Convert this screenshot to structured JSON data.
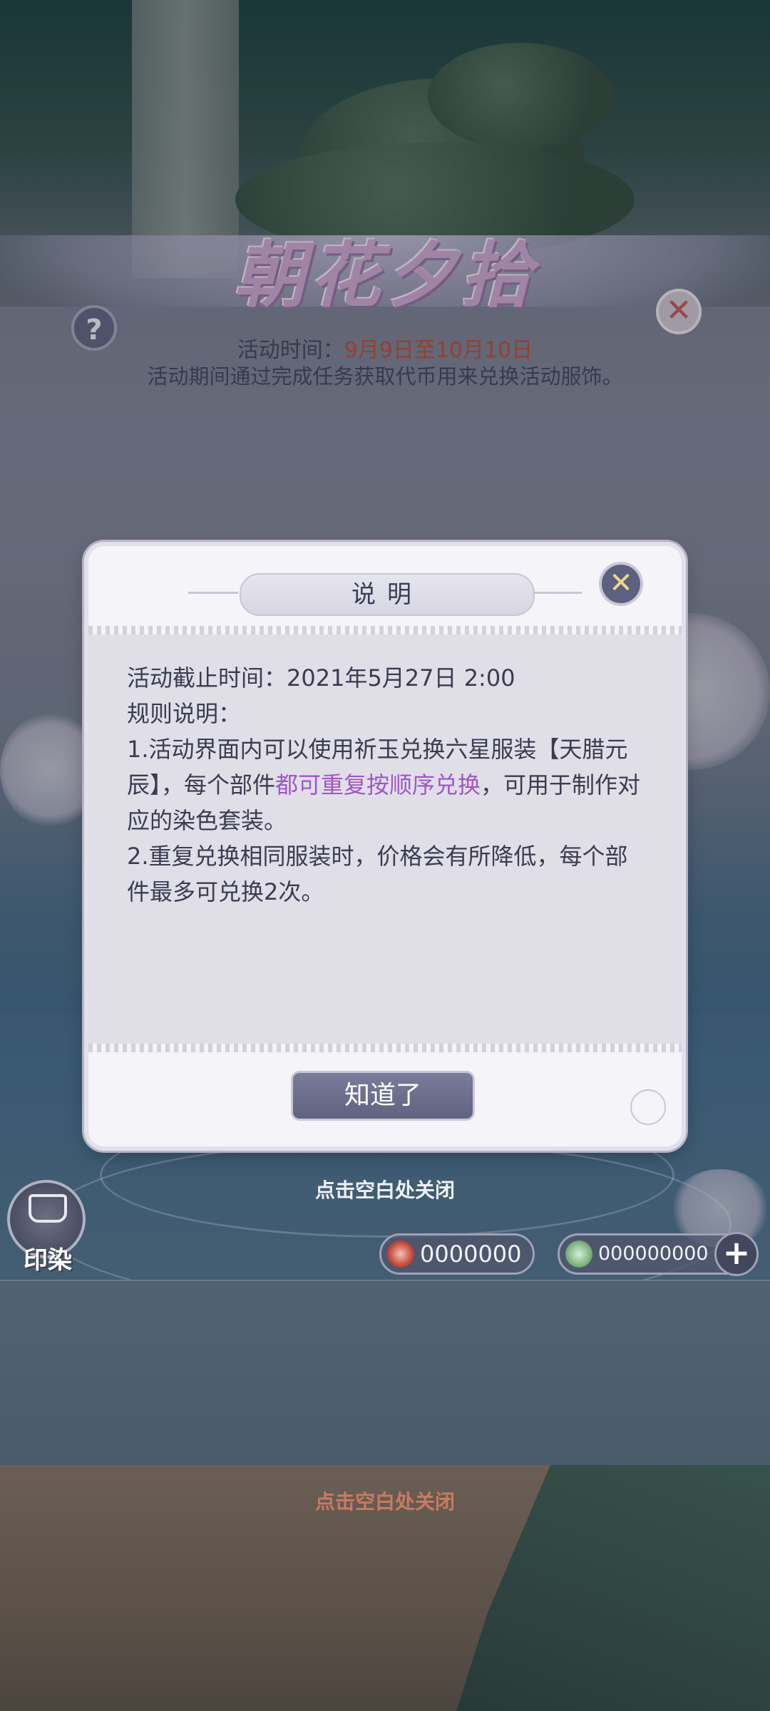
{
  "event": {
    "title": "朝花夕拾",
    "time_label": "活动时间：",
    "time_value": "9月9日至10月10日",
    "description": "活动期间通过完成任务获取代币用来兑换活动服饰。",
    "help_icon": "?",
    "close_icon": "✕"
  },
  "modal": {
    "title": "说明",
    "close_icon": "✕",
    "deadline": "活动截止时间：2021年5月27日 2:00",
    "rules_heading": "规则说明：",
    "rule1_prefix": "1.活动界面内可以使用祈玉兑换六星服装【天腊元辰】，每个部件",
    "rule1_highlight": "都可重复按顺序兑换",
    "rule1_suffix": "，可用于制作对应的染色套装。",
    "rule2": "2.重复兑换相同服装时，价格会有所降低，每个部件最多可兑换2次。",
    "ok_label": "知道了",
    "highlight_color": "#a155c8"
  },
  "hints": {
    "tap_close_1": "点击空白处关闭",
    "tap_close_2": "点击空白处关闭"
  },
  "bottom_bar": {
    "dye_label": "印染",
    "currency1_value": "0000000",
    "currency2_value": "000000000",
    "add_icon": "+"
  }
}
